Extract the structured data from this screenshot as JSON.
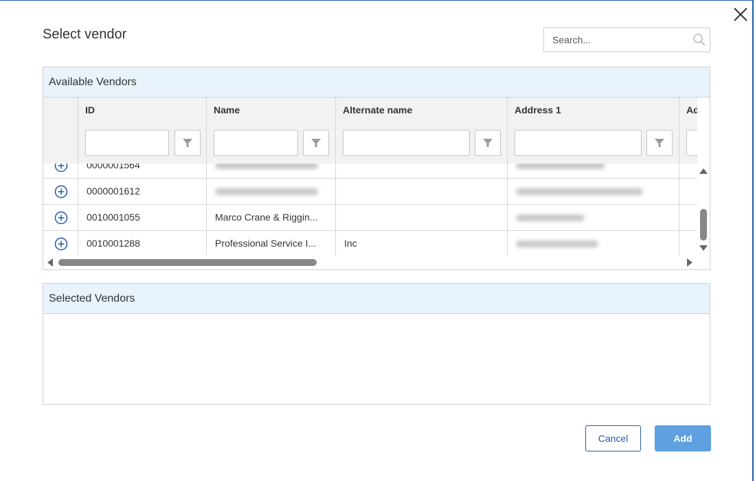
{
  "dialog": {
    "title": "Select vendor",
    "search_placeholder": "Search..."
  },
  "available": {
    "header": "Available Vendors",
    "columns": [
      "ID",
      "Name",
      "Alternate name",
      "Address 1",
      "Ad"
    ],
    "rows": [
      {
        "id": "0000001564",
        "name": "",
        "alt": "",
        "addr": ""
      },
      {
        "id": "0000001612",
        "name": "",
        "alt": "",
        "addr": ""
      },
      {
        "id": "0010001055",
        "name": "Marco Crane & Riggin...",
        "alt": "",
        "addr": ""
      },
      {
        "id": "0010001288",
        "name": "Professional Service I...",
        "alt": "Inc",
        "addr": ""
      }
    ]
  },
  "selected": {
    "header": "Selected Vendors"
  },
  "buttons": {
    "cancel": "Cancel",
    "add": "Add"
  },
  "colors": {
    "accent": "#1e5aa8",
    "add_button": "#5fa0e0",
    "panel_header": "#e8f3fb"
  },
  "icons": {
    "close": "close-icon",
    "search": "search-icon",
    "filter": "filter-icon",
    "add_row": "plus-circle-icon"
  }
}
